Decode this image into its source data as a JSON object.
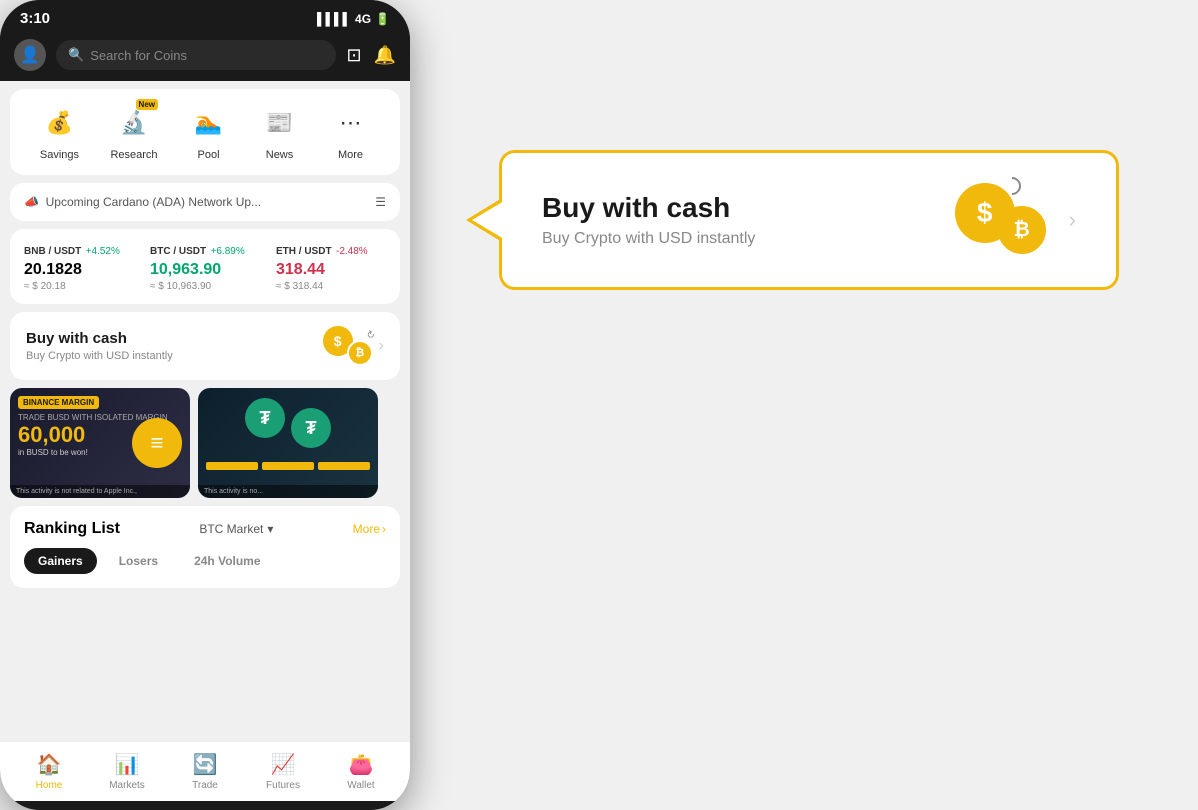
{
  "status": {
    "time": "3:10",
    "signal": "▌▌▌▌",
    "network": "4G",
    "battery": "🔋"
  },
  "header": {
    "search_placeholder": "Search for Coins",
    "avatar_icon": "👤"
  },
  "quick_actions": [
    {
      "label": "Savings",
      "icon": "💰",
      "new_badge": false
    },
    {
      "label": "Research",
      "icon": "🔬",
      "new_badge": true
    },
    {
      "label": "Pool",
      "icon": "🏊",
      "new_badge": false
    },
    {
      "label": "News",
      "icon": "📰",
      "new_badge": false
    },
    {
      "label": "More",
      "icon": "⋯",
      "new_badge": false
    }
  ],
  "announcement": {
    "text": "Upcoming Cardano (ADA) Network Up...",
    "icon": "📣"
  },
  "tickers": [
    {
      "pair": "BNB / USDT",
      "change": "+4.52%",
      "price": "20.1828",
      "usd": "≈ $ 20.18",
      "positive": true
    },
    {
      "pair": "BTC / USDT",
      "change": "+6.89%",
      "price": "10,963.90",
      "usd": "≈ $ 10,963.90",
      "positive": true
    },
    {
      "pair": "ETH / USDT",
      "change": "-2.48%",
      "price": "318.44",
      "usd": "≈ $ 318.44",
      "positive": false
    }
  ],
  "buy_cash": {
    "title": "Buy with cash",
    "subtitle": "Buy Crypto with USD instantly"
  },
  "promo": {
    "left": {
      "badge": "BINANCE MARGIN",
      "subtitle": "TRADE BUSD WITH ISOLATED MARGIN",
      "amount": "60,000",
      "desc": "in BUSD to be won!",
      "notice": "This activity is not related to Apple Inc.,"
    },
    "right": {
      "notice": "This activity is no..."
    }
  },
  "ranking": {
    "title": "Ranking List",
    "market": "BTC Market",
    "more": "More",
    "tabs": [
      {
        "label": "Gainers",
        "active": true
      },
      {
        "label": "Losers",
        "active": false
      },
      {
        "label": "24h Volume",
        "active": false
      }
    ]
  },
  "nav": [
    {
      "label": "Home",
      "icon": "🏠",
      "active": true
    },
    {
      "label": "Markets",
      "icon": "📊",
      "active": false
    },
    {
      "label": "Trade",
      "icon": "🔄",
      "active": false
    },
    {
      "label": "Futures",
      "icon": "📈",
      "active": false
    },
    {
      "label": "Wallet",
      "icon": "👛",
      "active": false
    }
  ],
  "callout": {
    "title": "Buy with cash",
    "subtitle": "Buy Crypto with USD instantly"
  }
}
